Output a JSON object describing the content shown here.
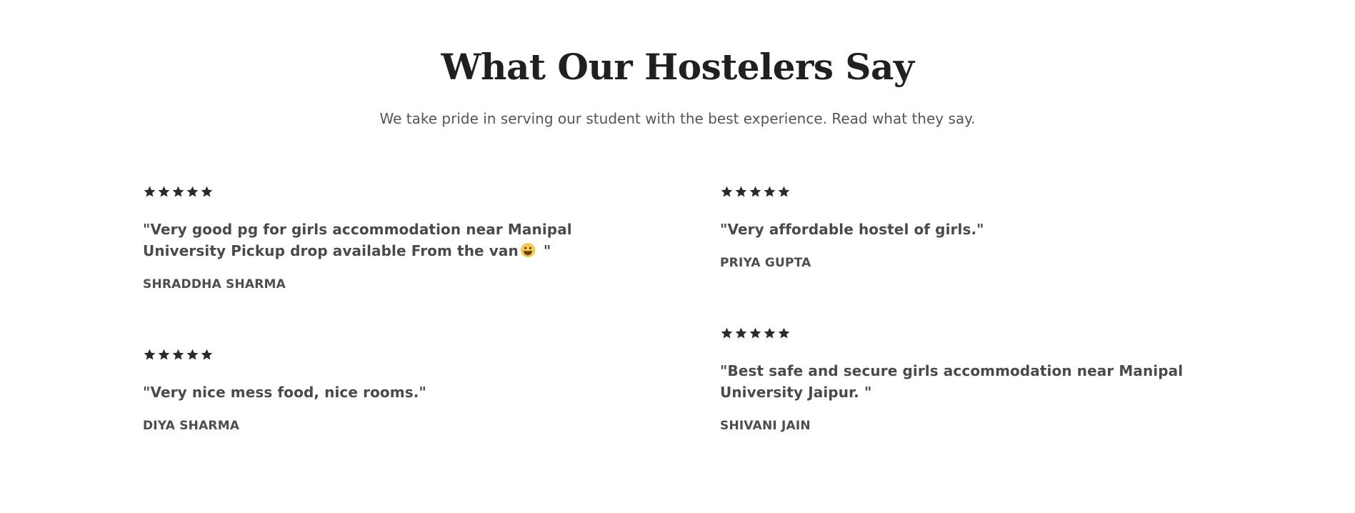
{
  "section": {
    "title": "What Our Hostelers Say",
    "subtitle": "We take pride in serving our student with the best experience. Read what they say."
  },
  "rating_icon": "star-icon",
  "star_color": "#2b2b2b",
  "testimonials": [
    {
      "rating": 5,
      "quote_part1": "\"Very good pg for girls accommodation near Manipal University Pickup drop available From the van",
      "emoji": "grinning-face-emoji",
      "quote_part2": " \"",
      "author": "SHRADDHA SHARMA"
    },
    {
      "rating": 5,
      "quote": "\"Very nice mess food, nice rooms.\"",
      "author": "DIYA SHARMA"
    },
    {
      "rating": 5,
      "quote": "\"Very affordable hostel of girls.\"",
      "author": "PRIYA GUPTA"
    },
    {
      "rating": 5,
      "quote": "\"Best safe and secure girls accommodation near Manipal University Jaipur. \"",
      "author": "SHIVANI JAIN"
    }
  ]
}
